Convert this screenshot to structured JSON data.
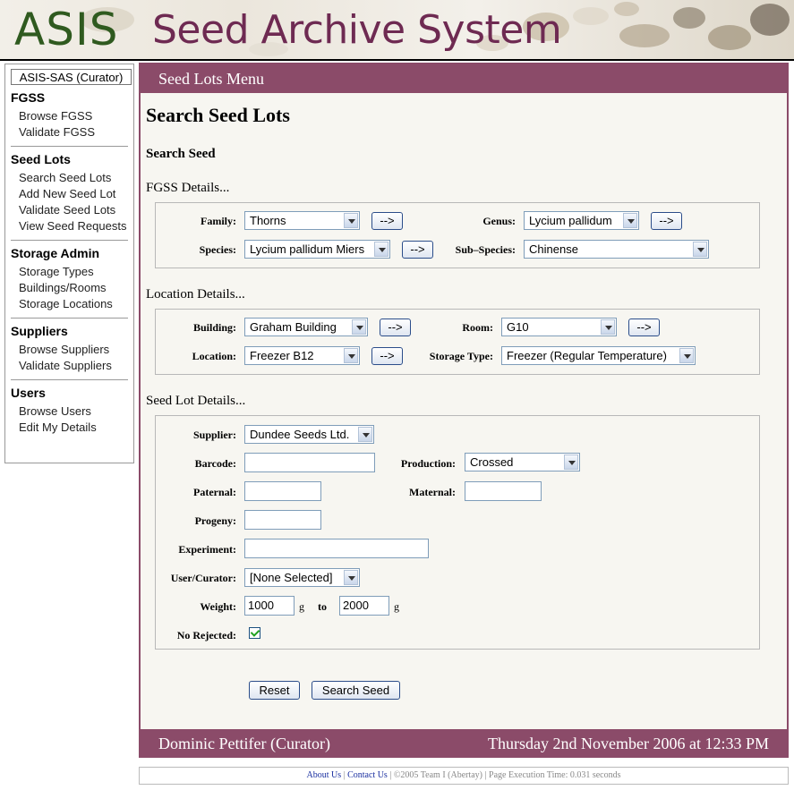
{
  "header": {
    "logo": "ASIS",
    "title": "Seed Archive System"
  },
  "sidebar": {
    "badge": "ASIS-SAS (Curator)",
    "sections": [
      {
        "title": "FGSS",
        "items": [
          "Browse FGSS",
          "Validate FGSS"
        ]
      },
      {
        "title": "Seed Lots",
        "items": [
          "Search Seed Lots",
          "Add New Seed Lot",
          "Validate Seed Lots",
          "View Seed Requests"
        ]
      },
      {
        "title": "Storage Admin",
        "items": [
          "Storage Types",
          "Buildings/Rooms",
          "Storage Locations"
        ]
      },
      {
        "title": "Suppliers",
        "items": [
          "Browse Suppliers",
          "Validate Suppliers"
        ]
      },
      {
        "title": "Users",
        "items": [
          "Browse Users",
          "Edit My Details"
        ]
      }
    ]
  },
  "main": {
    "menu_bar": "Seed Lots Menu",
    "page_title": "Search Seed Lots",
    "sub_title": "Search Seed",
    "fgss": {
      "heading": "FGSS Details...",
      "family_label": "Family:",
      "family_value": "Thorns",
      "genus_label": "Genus:",
      "genus_value": "Lycium pallidum",
      "species_label": "Species:",
      "species_value": "Lycium pallidum Miers",
      "subspecies_label": "Sub–Species:",
      "subspecies_value": "Chinense"
    },
    "location": {
      "heading": "Location Details...",
      "building_label": "Building:",
      "building_value": "Graham Building",
      "room_label": "Room:",
      "room_value": "G10",
      "location_label": "Location:",
      "location_value": "Freezer B12",
      "storage_type_label": "Storage Type:",
      "storage_type_value": "Freezer (Regular Temperature)"
    },
    "seedlot": {
      "heading": "Seed Lot Details...",
      "supplier_label": "Supplier:",
      "supplier_value": "Dundee Seeds Ltd.",
      "barcode_label": "Barcode:",
      "barcode_value": "",
      "production_label": "Production:",
      "production_value": "Crossed",
      "paternal_label": "Paternal:",
      "paternal_value": "",
      "maternal_label": "Maternal:",
      "maternal_value": "",
      "progeny_label": "Progeny:",
      "progeny_value": "",
      "experiment_label": "Experiment:",
      "experiment_value": "",
      "user_label": "User/Curator:",
      "user_value": "[None Selected]",
      "weight_label": "Weight:",
      "weight_from": "1000",
      "weight_unit": "g",
      "weight_to_label": "to",
      "weight_to": "2000",
      "no_rejected_label": "No Rejected:",
      "no_rejected_checked": true
    },
    "arrow_label": "-->",
    "reset_label": "Reset",
    "search_label": "Search Seed",
    "user_name": "Dominic Pettifer (Curator)",
    "datetime": "Thursday 2nd November 2006 at 12:33 PM"
  },
  "footer": {
    "about": "About Us",
    "sep1": " | ",
    "contact": "Contact Us",
    "rest": " | ©2005 Team I (Abertay) | Page Execution Time: 0.031 seconds"
  },
  "colors": {
    "accent": "#8b4b69",
    "logo_green": "#2f5a1f",
    "title_purple": "#6e2a52"
  }
}
